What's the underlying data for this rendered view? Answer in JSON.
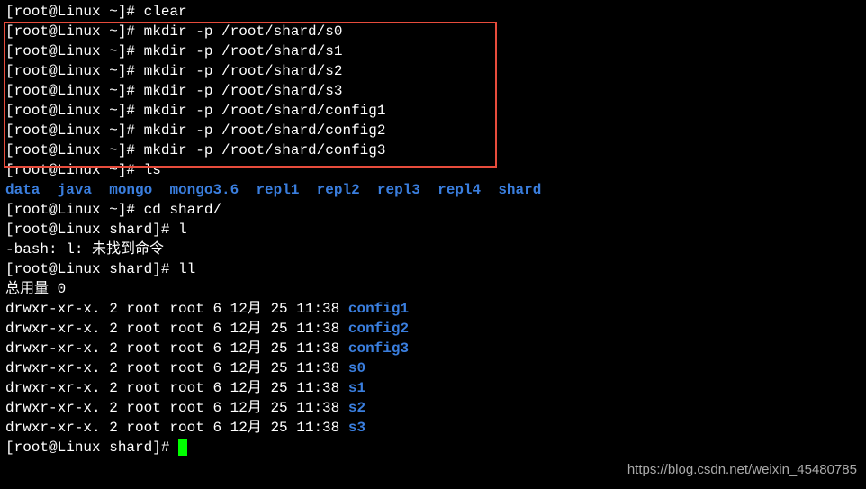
{
  "prompt_home": "[root@Linux ~]# ",
  "prompt_shard": "[root@Linux shard]# ",
  "commands": {
    "clear": "clear",
    "mkdir_s0": "mkdir -p /root/shard/s0",
    "mkdir_s1": "mkdir -p /root/shard/s1",
    "mkdir_s2": "mkdir -p /root/shard/s2",
    "mkdir_s3": "mkdir -p /root/shard/s3",
    "mkdir_c1": "mkdir -p /root/shard/config1",
    "mkdir_c2": "mkdir -p /root/shard/config2",
    "mkdir_c3": "mkdir -p /root/shard/config3",
    "ls": "ls",
    "cd": "cd shard/",
    "l": "l",
    "ll": "ll"
  },
  "ls_output": {
    "items": [
      "data",
      "java",
      "mongo",
      "mongo3.6",
      "repl1",
      "repl2",
      "repl3",
      "repl4",
      "shard"
    ]
  },
  "bash_error": "-bash: l: 未找到命令",
  "ll_header": "总用量 0",
  "ll_rows": [
    {
      "perms": "drwxr-xr-x. 2 root root 6 12月 25 11:38 ",
      "name": "config1"
    },
    {
      "perms": "drwxr-xr-x. 2 root root 6 12月 25 11:38 ",
      "name": "config2"
    },
    {
      "perms": "drwxr-xr-x. 2 root root 6 12月 25 11:38 ",
      "name": "config3"
    },
    {
      "perms": "drwxr-xr-x. 2 root root 6 12月 25 11:38 ",
      "name": "s0"
    },
    {
      "perms": "drwxr-xr-x. 2 root root 6 12月 25 11:38 ",
      "name": "s1"
    },
    {
      "perms": "drwxr-xr-x. 2 root root 6 12月 25 11:38 ",
      "name": "s2"
    },
    {
      "perms": "drwxr-xr-x. 2 root root 6 12月 25 11:38 ",
      "name": "s3"
    }
  ],
  "watermark": "https://blog.csdn.net/weixin_45480785"
}
